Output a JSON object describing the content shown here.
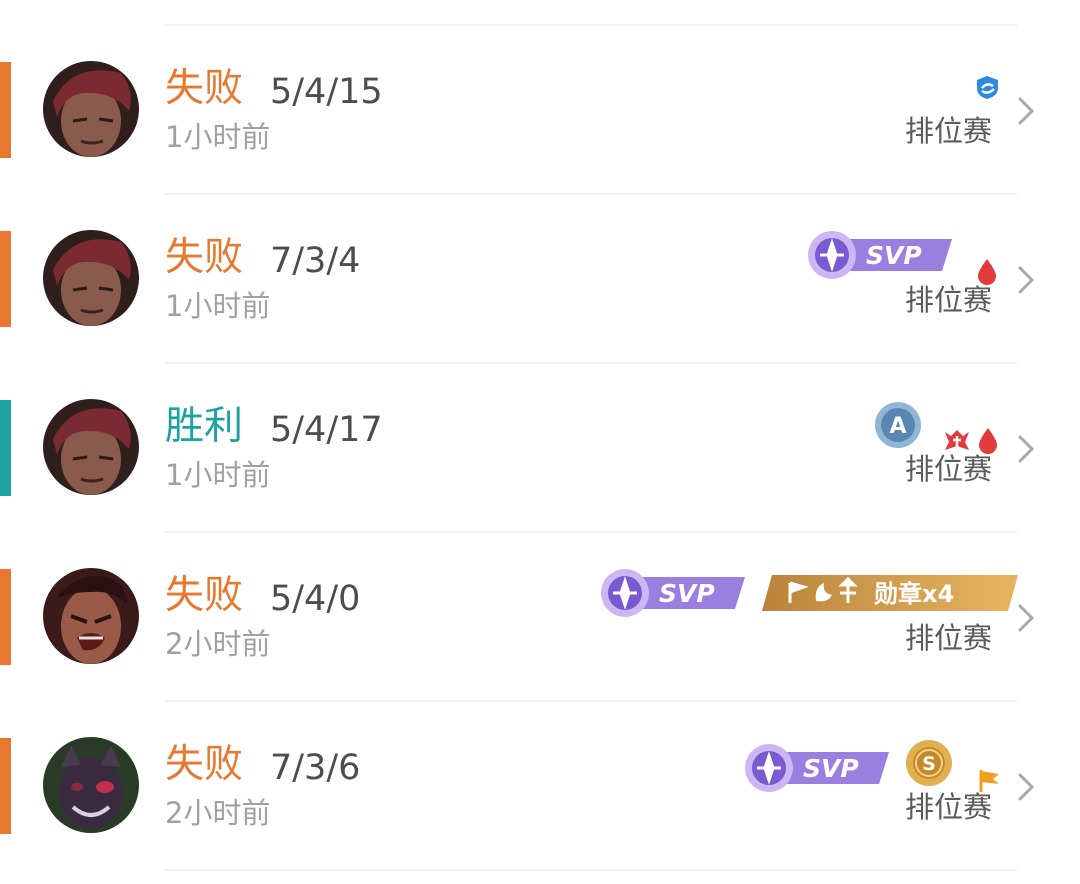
{
  "colors": {
    "loss": "#e8782f",
    "win": "#1ea3a3",
    "svp": "#8a6ed8",
    "medal": "#d6a04c"
  },
  "matches": [
    {
      "result": "失败",
      "outcome": "loss",
      "kda": "5/4/15",
      "time": "1小时前",
      "mode": "排位赛",
      "avatar_icon": "hero-avatar-red-hair",
      "badges": [
        "team-support-icon"
      ]
    },
    {
      "result": "失败",
      "outcome": "loss",
      "kda": "7/3/4",
      "time": "1小时前",
      "mode": "排位赛",
      "avatar_icon": "hero-avatar-red-hair",
      "badges": [
        "svp-badge",
        "first-blood-icon"
      ],
      "svp_label": "SVP"
    },
    {
      "result": "胜利",
      "outcome": "win",
      "kda": "5/4/17",
      "time": "1小时前",
      "mode": "排位赛",
      "avatar_icon": "hero-avatar-red-hair",
      "badges": [
        "grade-a-badge",
        "tower-icon",
        "first-blood-icon"
      ],
      "grade": "A"
    },
    {
      "result": "失败",
      "outcome": "loss",
      "kda": "5/4/0",
      "time": "2小时前",
      "mode": "排位赛",
      "avatar_icon": "hero-avatar-warrior",
      "badges": [
        "svp-badge",
        "medal-badge"
      ],
      "svp_label": "SVP",
      "medal_label": "勋章x4"
    },
    {
      "result": "失败",
      "outcome": "loss",
      "kda": "7/3/6",
      "time": "2小时前",
      "mode": "排位赛",
      "avatar_icon": "hero-avatar-purple-beast",
      "badges": [
        "svp-badge",
        "grade-s-badge",
        "flag-icon"
      ],
      "svp_label": "SVP",
      "grade": "S"
    }
  ]
}
